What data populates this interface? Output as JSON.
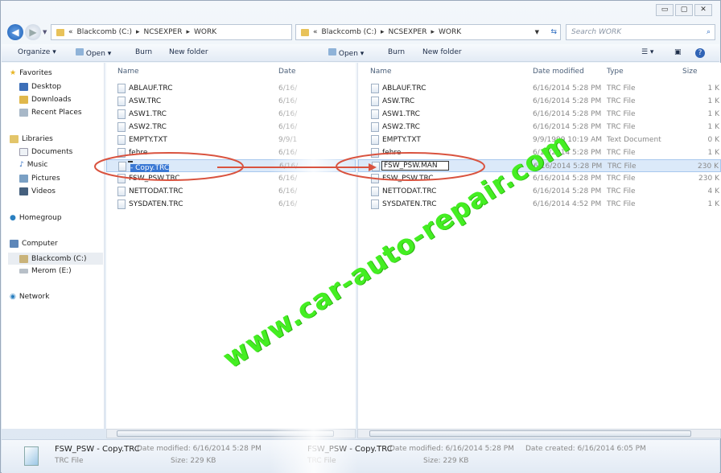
{
  "window_controls": [
    "minimize",
    "maximize",
    "close"
  ],
  "left": {
    "breadcrumb": [
      "Blackcomb (C:)",
      "NCSEXPER",
      "WORK"
    ],
    "toolbar": {
      "organize": "Organize",
      "open": "Open",
      "burn": "Burn",
      "new_folder": "New folder"
    },
    "columns": {
      "name": "Name",
      "date": "Date"
    },
    "files": [
      "ABLAUF.TRC",
      "ASW.TRC",
      "ASW1.TRC",
      "ASW2.TRC",
      "EMPTY.TXT",
      "fehre",
      "FSW_PSW - Copy.TRC",
      "FSW_PSW.TRC",
      "NETTODAT.TRC",
      "SYSDATEN.TRC"
    ],
    "rename": {
      "kept": "FSW_PSW",
      "selected": " - Copy.TRC"
    },
    "dates": [
      "6/16/",
      "6/16/",
      "6/16/",
      "6/16/",
      "9/9/1",
      "6/16/",
      "6/16/",
      "6/16/",
      "6/16/",
      "6/16/"
    ]
  },
  "navpane": {
    "favorites": "Favorites",
    "fav_items": [
      "Desktop",
      "Downloads",
      "Recent Places"
    ],
    "libraries": "Libraries",
    "lib_items": [
      "Documents",
      "Music",
      "Pictures",
      "Videos"
    ],
    "homegroup": "Homegroup",
    "computer": "Computer",
    "drives": [
      "Blackcomb (C:)",
      "Merom (E:)"
    ],
    "network": "Network"
  },
  "right": {
    "breadcrumb": [
      "Blackcomb (C:)",
      "NCSEXPER",
      "WORK"
    ],
    "search_placeholder": "Search WORK",
    "toolbar": {
      "open": "Open",
      "burn": "Burn",
      "new_folder": "New folder"
    },
    "columns": {
      "name": "Name",
      "date": "Date modified",
      "type": "Type",
      "size": "Size"
    },
    "files": [
      {
        "name": "ABLAUF.TRC",
        "date": "6/16/2014 5:28 PM",
        "type": "TRC File",
        "size": "1 K"
      },
      {
        "name": "ASW.TRC",
        "date": "6/16/2014 5:28 PM",
        "type": "TRC File",
        "size": "1 K"
      },
      {
        "name": "ASW1.TRC",
        "date": "6/16/2014 5:28 PM",
        "type": "TRC File",
        "size": "1 K"
      },
      {
        "name": "ASW2.TRC",
        "date": "6/16/2014 5:28 PM",
        "type": "TRC File",
        "size": "1 K"
      },
      {
        "name": "EMPTY.TXT",
        "date": "9/9/1999 10:19 AM",
        "type": "Text Document",
        "size": "0 K"
      },
      {
        "name": "fehre",
        "date": "6/16/2014 5:28 PM",
        "type": "TRC File",
        "size": "1 K"
      },
      {
        "name": "FSW_PSW.MAN",
        "date": "6/16/2014 5:28 PM",
        "type": "TRC File",
        "size": "230 K"
      },
      {
        "name": "FSW_PSW.TRC",
        "date": "6/16/2014 5:28 PM",
        "type": "TRC File",
        "size": "230 K"
      },
      {
        "name": "NETTODAT.TRC",
        "date": "6/16/2014 5:28 PM",
        "type": "TRC File",
        "size": "4 K"
      },
      {
        "name": "SYSDATEN.TRC",
        "date": "6/16/2014 4:52 PM",
        "type": "TRC File",
        "size": "1 K"
      }
    ]
  },
  "details": {
    "left": {
      "name": "FSW_PSW - Copy.TRC",
      "modified": "Date modified: 6/16/2014 5:28 PM",
      "type": "TRC File",
      "size": "Size: 229 KB"
    },
    "right": {
      "name": "FSW_PSW - Copy.TRC",
      "modified": "Date modified: 6/16/2014 5:28 PM",
      "created": "Date created: 6/16/2014 6:05 PM",
      "type": "TRC File",
      "size": "Size: 229 KB"
    }
  },
  "watermark": "www.car-auto-repair.com",
  "annotation_color": "#d9533f",
  "watermark_color": "#44ee22"
}
